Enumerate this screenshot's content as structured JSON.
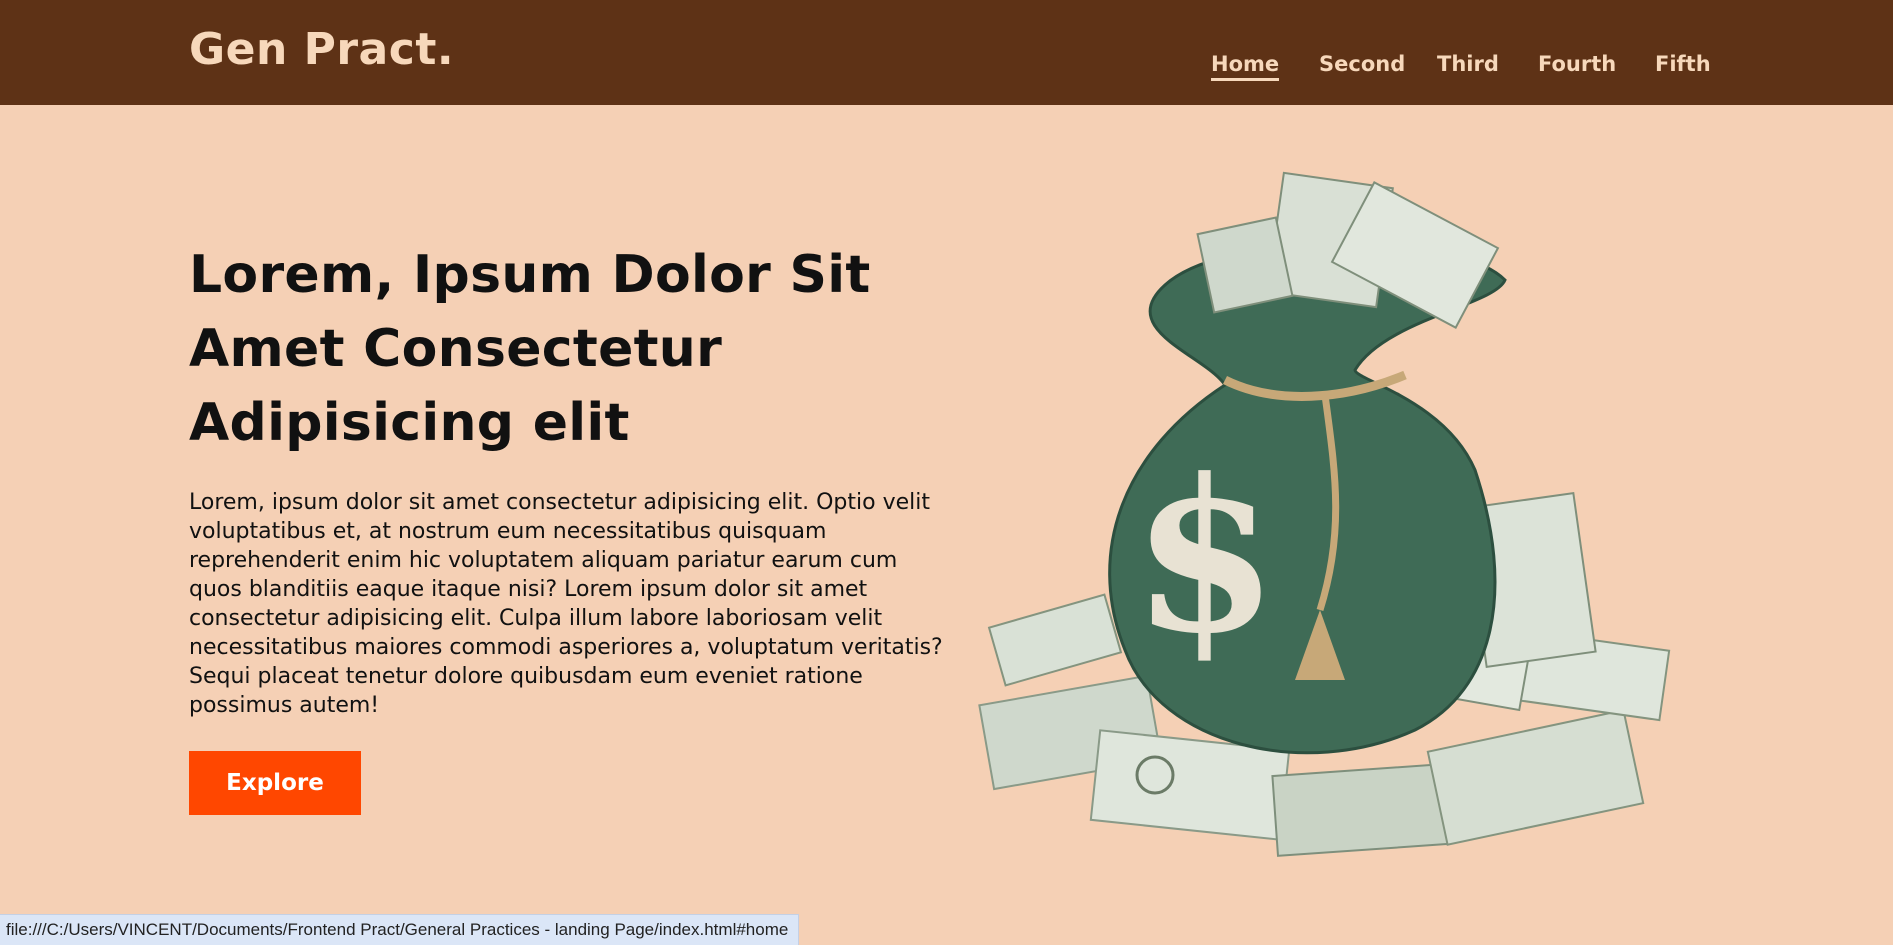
{
  "header": {
    "logo": "Gen Pract.",
    "nav": [
      {
        "label": "Home",
        "active": true
      },
      {
        "label": "Second",
        "active": false
      },
      {
        "label": "Third",
        "active": false
      },
      {
        "label": "Fourth",
        "active": false
      },
      {
        "label": "Fifth",
        "active": false
      }
    ]
  },
  "hero": {
    "title": "Lorem, Ipsum Dolor Sit Amet Consectetur Adipisicing elit",
    "text": "Lorem, ipsum dolor sit amet consectetur adipisicing elit. Optio velit voluptatibus et, at nostrum eum necessitatibus quisquam reprehenderit enim hic voluptatem aliquam pariatur earum cum quos blanditiis eaque itaque nisi? Lorem ipsum dolor sit amet consectetur adipisicing elit. Culpa illum labore laboriosam velit necessitatibus maiores commodi asperiores a, voluptatum veritatis? Sequi placeat tenetur dolore quibusdam eum eveniet ratione possimus autem!",
    "button_label": "Explore",
    "image_symbol": "$"
  },
  "status_bar": {
    "url": "file:///C:/Users/VINCENT/Documents/Frontend Pract/General Practices - landing Page/index.html#home"
  },
  "colors": {
    "header_bg": "#5e3216",
    "page_bg": "#f5d0b5",
    "accent": "#ff4700",
    "nav_text": "#f7d8bb",
    "bag_green": "#3f6b56"
  }
}
